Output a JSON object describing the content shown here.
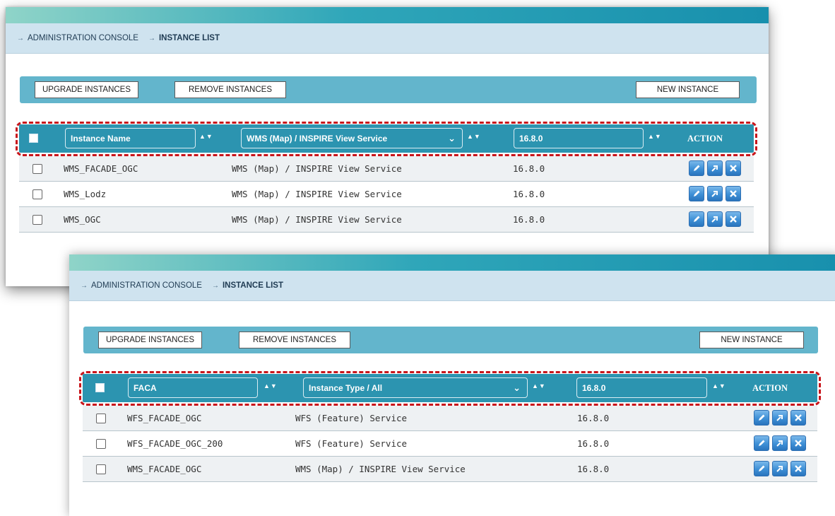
{
  "panels": [
    {
      "breadcrumb": [
        "ADMINISTRATION CONSOLE",
        "INSTANCE LIST"
      ],
      "toolbar": {
        "upgrade": "UPGRADE INSTANCES",
        "remove": "REMOVE INSTANCES",
        "new": "NEW INSTANCE"
      },
      "header": {
        "name_filter": "Instance Name",
        "type_filter": "WMS (Map) / INSPIRE View Service",
        "version_filter": "16.8.0",
        "sort": "▲▼",
        "action": "ACTION"
      },
      "rows": [
        {
          "name": "WMS_FACADE_OGC",
          "type": "WMS (Map) / INSPIRE View Service",
          "version": "16.8.0"
        },
        {
          "name": "WMS_Lodz",
          "type": "WMS (Map) / INSPIRE View Service",
          "version": "16.8.0"
        },
        {
          "name": "WMS_OGC",
          "type": "WMS (Map) / INSPIRE View Service",
          "version": "16.8.0"
        }
      ]
    },
    {
      "breadcrumb": [
        "ADMINISTRATION CONSOLE",
        "INSTANCE LIST"
      ],
      "toolbar": {
        "upgrade": "UPGRADE INSTANCES",
        "remove": "REMOVE INSTANCES",
        "new": "NEW INSTANCE"
      },
      "header": {
        "name_filter": "FACA",
        "type_filter": "Instance Type / All",
        "version_filter": "16.8.0",
        "sort": "▲▼",
        "action": "ACTION"
      },
      "rows": [
        {
          "name": "WFS_FACADE_OGC",
          "type": "WFS (Feature) Service",
          "version": "16.8.0"
        },
        {
          "name": "WFS_FACADE_OGC_200",
          "type": "WFS (Feature) Service",
          "version": "16.8.0"
        },
        {
          "name": "WMS_FACADE_OGC",
          "type": "WMS (Map) / INSPIRE View Service",
          "version": "16.8.0"
        }
      ]
    }
  ],
  "breadcrumb_arrow": "→",
  "icons": {
    "edit": "pencil-icon",
    "open": "arrow-icon",
    "delete": "close-icon"
  },
  "colors": {
    "header": "#2c94b0",
    "toolbar": "#63b5cc",
    "highlight": "#c8151b",
    "breadcrumb_bg": "#cfe3ef"
  }
}
